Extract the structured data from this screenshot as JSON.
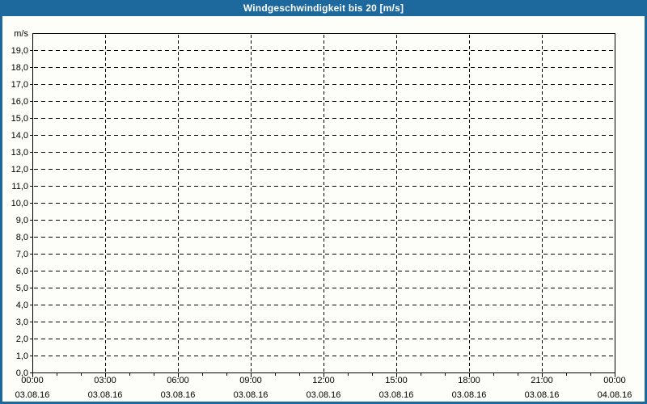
{
  "title_bar": {
    "title": "Windgeschwindigkeit bis 20 [m/s]"
  },
  "colors": {
    "titlebar_bg": "#1d689c",
    "border": "#1d689c",
    "plot_bg": "#fdfdfa",
    "grid": "#000000",
    "text": "#000000",
    "title_text": "#ffffff"
  },
  "chart_data": {
    "type": "line",
    "title": "Windgeschwindigkeit bis 20 [m/s]",
    "xlabel": "",
    "ylabel": "m/s",
    "ylim": [
      0,
      20
    ],
    "ytick_step": 1.0,
    "ytick_labels": [
      "0,0",
      "1,0",
      "2,0",
      "3,0",
      "4,0",
      "5,0",
      "6,0",
      "7,0",
      "8,0",
      "9,0",
      "10,0",
      "11,0",
      "12,0",
      "13,0",
      "14,0",
      "15,0",
      "16,0",
      "17,0",
      "18,0",
      "19,0"
    ],
    "x_hours": 24,
    "x_minor_step_hours": 1,
    "x_major_step_hours": 3,
    "x_major_ticks": [
      {
        "time": "00:00",
        "date": "03.08.16"
      },
      {
        "time": "03:00",
        "date": "03.08.16"
      },
      {
        "time": "06:00",
        "date": "03.08.16"
      },
      {
        "time": "09:00",
        "date": "03.08.16"
      },
      {
        "time": "12:00",
        "date": "03.08.16"
      },
      {
        "time": "15:00",
        "date": "03.08.16"
      },
      {
        "time": "18:00",
        "date": "03.08.16"
      },
      {
        "time": "21:00",
        "date": "03.08.16"
      },
      {
        "time": "00:00",
        "date": "04.08.16"
      }
    ],
    "grid": {
      "style": "dashed",
      "horizontal": true,
      "vertical": true
    },
    "legend": "none",
    "series": []
  }
}
